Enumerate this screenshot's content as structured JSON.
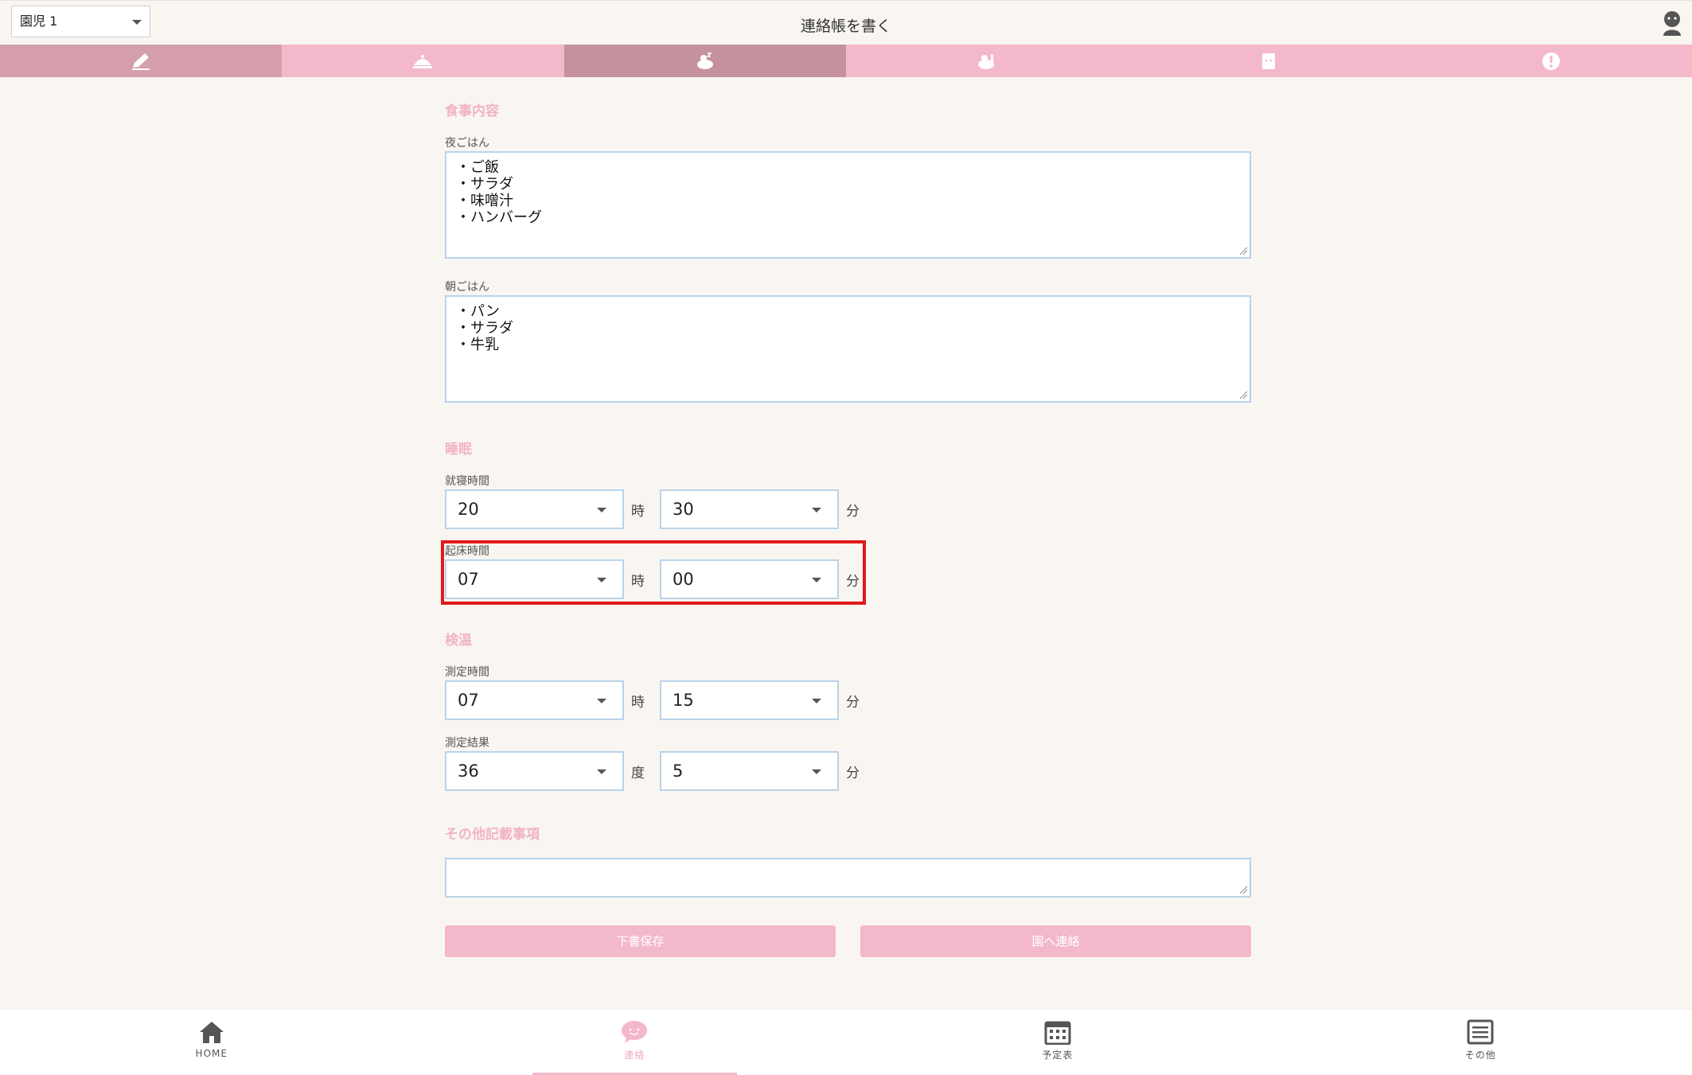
{
  "header": {
    "child_select": "園児 1",
    "title": "連絡帳を書く"
  },
  "tabs": [
    {
      "icon": "pencil-icon"
    },
    {
      "icon": "meal-icon"
    },
    {
      "icon": "sleep-icon"
    },
    {
      "icon": "temperature-icon"
    },
    {
      "icon": "toilet-icon"
    },
    {
      "icon": "alert-icon"
    }
  ],
  "meal": {
    "section_title": "食事内容",
    "dinner_label": "夜ごはん",
    "dinner_lines": [
      "・ご飯",
      "・サラダ",
      "・味噌汁",
      "・ハンバーグ"
    ],
    "breakfast_label": "朝ごはん",
    "breakfast_lines": [
      "・パン",
      "・サラダ",
      "・牛乳"
    ]
  },
  "sleep": {
    "section_title": "睡眠",
    "bedtime_label": "就寝時間",
    "bedtime_hour": "20",
    "bedtime_minute": "30",
    "wake_label": "起床時間",
    "wake_hour": "07",
    "wake_minute": "00",
    "hour_unit": "時",
    "minute_unit": "分"
  },
  "temperature": {
    "section_title": "検温",
    "time_label": "測定時間",
    "time_hour": "07",
    "time_minute": "15",
    "hour_unit": "時",
    "minute_unit": "分",
    "result_label": "測定結果",
    "result_degree": "36",
    "result_decimal": "5",
    "degree_unit": "度",
    "decimal_unit": "分"
  },
  "notes": {
    "section_title": "その他記載事項",
    "value": ""
  },
  "buttons": {
    "draft": "下書保存",
    "send": "園へ連絡"
  },
  "bottom_nav": [
    {
      "label": "HOME",
      "icon": "home-icon"
    },
    {
      "label": "連絡",
      "icon": "chat-icon"
    },
    {
      "label": "予定表",
      "icon": "calendar-icon"
    },
    {
      "label": "その他",
      "icon": "menu-icon"
    }
  ],
  "colors": {
    "accent_pink": "#f4b8cb",
    "section_pink": "#f2b3c5",
    "input_border": "#b9d3ea",
    "highlight_red": "#e01919"
  }
}
